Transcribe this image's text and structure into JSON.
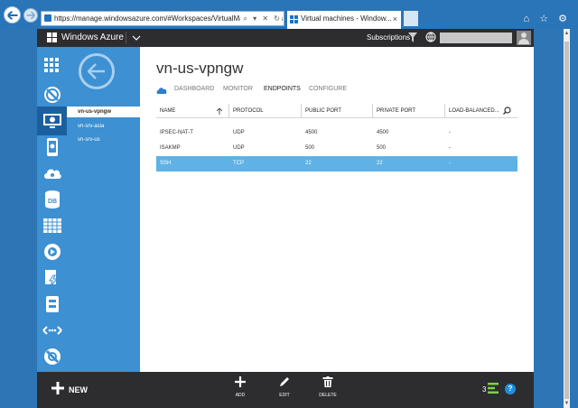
{
  "browser": {
    "url": "https://manage.windowsazure.com/#Workspaces/VirtualMachineExtens",
    "tab_title": "Virtual machines - Window...",
    "tab_close": "×",
    "addr_tools": "⌕ ▾ ✕ ↻",
    "window_tools": "⌂ ☆ ⚙"
  },
  "topbar": {
    "brand": "Windows Azure",
    "subscriptions": "Subscriptions"
  },
  "rail": [
    {
      "icon": "grid-icon",
      "active": false
    },
    {
      "icon": "globe-slash-icon",
      "active": false
    },
    {
      "icon": "virtual-machine-icon",
      "active": true
    },
    {
      "icon": "mobile-service-icon",
      "active": false
    },
    {
      "icon": "cloud-service-icon",
      "active": false
    },
    {
      "icon": "db-icon",
      "active": false
    },
    {
      "icon": "table-icon",
      "active": false
    },
    {
      "icon": "media-icon",
      "active": false
    },
    {
      "icon": "bolt-doc-icon",
      "active": false
    },
    {
      "icon": "storage-icon",
      "active": false
    },
    {
      "icon": "network-icon",
      "active": false
    },
    {
      "icon": "ban-icon",
      "active": false
    }
  ],
  "rail_labels": {
    "db": "DB"
  },
  "sidebar": {
    "items": [
      {
        "label": "vn-us-vpngw",
        "active": true
      },
      {
        "label": "vn-srv-asia",
        "active": false
      },
      {
        "label": "vn-srv-us",
        "active": false
      }
    ]
  },
  "main": {
    "title": "vn-us-vpngw",
    "tabs": [
      "DASHBOARD",
      "MONITOR",
      "ENDPOINTS",
      "CONFIGURE"
    ],
    "active_tab": "ENDPOINTS",
    "columns": [
      "NAME",
      "PROTOCOL",
      "PUBLIC PORT",
      "PRIVATE PORT",
      "LOAD-BALANCED..."
    ],
    "rows": [
      {
        "name": "IPSEC-NAT-T",
        "protocol": "UDP",
        "public_port": "4500",
        "private_port": "4500",
        "load_balanced": "-",
        "selected": false
      },
      {
        "name": "ISAKMP",
        "protocol": "UDP",
        "public_port": "500",
        "private_port": "500",
        "load_balanced": "-",
        "selected": false
      },
      {
        "name": "SSH",
        "protocol": "TCP",
        "public_port": "22",
        "private_port": "22",
        "load_balanced": "-",
        "selected": true
      }
    ]
  },
  "cmdbar": {
    "new_label": "NEW",
    "add_label": "ADD",
    "edit_label": "EDIT",
    "delete_label": "DELETE",
    "activity_count": "3",
    "help_label": "?"
  },
  "colors": {
    "accent": "#3d90d1",
    "selected_row": "#5eb2e5",
    "dark_bar": "#2d2d30",
    "browser_frame": "#2a74b8"
  }
}
